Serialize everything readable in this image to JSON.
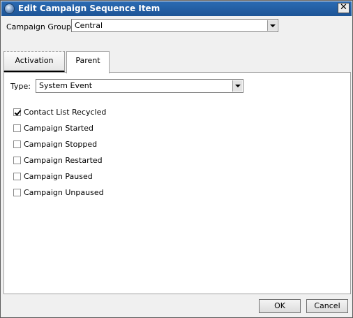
{
  "window": {
    "title": "Edit Campaign Sequence Item"
  },
  "campaign_group": {
    "label": "Campaign Group:",
    "value": "Central"
  },
  "tabs": [
    {
      "label": "Activation",
      "active": false
    },
    {
      "label": "Parent",
      "active": true
    }
  ],
  "type": {
    "label": "Type:",
    "value": "System Event"
  },
  "events": [
    {
      "label": "Contact List Recycled",
      "checked": true
    },
    {
      "label": "Campaign Started",
      "checked": false
    },
    {
      "label": "Campaign Stopped",
      "checked": false
    },
    {
      "label": "Campaign Restarted",
      "checked": false
    },
    {
      "label": "Campaign Paused",
      "checked": false
    },
    {
      "label": "Campaign Unpaused",
      "checked": false
    }
  ],
  "buttons": {
    "ok": "OK",
    "cancel": "Cancel",
    "close": "✕"
  }
}
